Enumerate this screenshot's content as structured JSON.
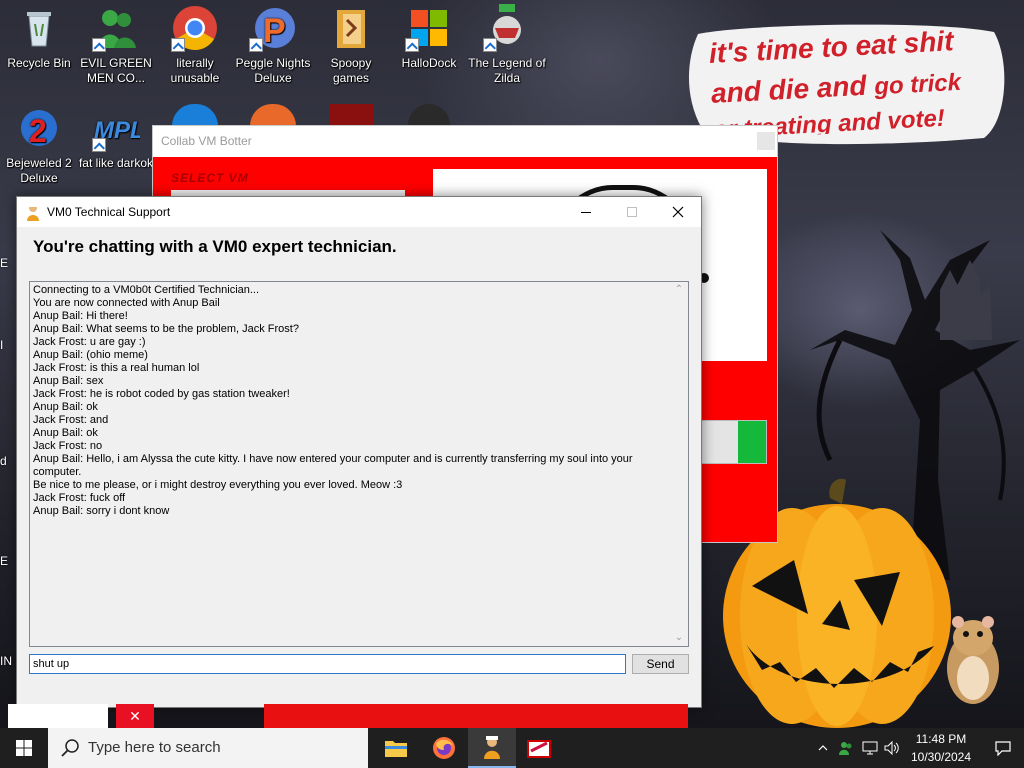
{
  "desktop": {
    "icons": [
      {
        "label": "Recycle Bin"
      },
      {
        "label": "EVIL GREEN MEN CO..."
      },
      {
        "label": "literally unusable"
      },
      {
        "label": "Peggle Nights Deluxe"
      },
      {
        "label": "Spoopy games"
      },
      {
        "label": "HalloDock"
      },
      {
        "label": "The Legend of Zilda"
      },
      {
        "label": "Bejeweled 2 Deluxe"
      },
      {
        "label": "fat like darkok"
      }
    ],
    "wallpaper_caption_line1": "it's time to eat shit",
    "wallpaper_caption_line2a": "and die and ",
    "wallpaper_caption_line2b": "go trick",
    "wallpaper_caption_line3": "or treating and vote!"
  },
  "botter": {
    "title": "Collab VM Botter",
    "select_label": "SELECT VM"
  },
  "support": {
    "title": "VM0 Technical Support",
    "heading": "You're chatting with a VM0 expert technician.",
    "chat_lines": [
      "Connecting to a VM0b0t Certified Technician...",
      "You are now connected with Anup Bail",
      "Anup Bail: Hi there!",
      "Anup Bail: What seems to be the problem, Jack Frost?",
      "Jack Frost: u are gay :)",
      "Anup Bail: (ohio meme)",
      "Jack Frost: is this a real human lol",
      "Anup Bail: sex",
      "Jack Frost: he is robot coded by gas station tweaker!",
      "Anup Bail: ok",
      "Jack Frost: and",
      "Anup Bail: ok",
      "Jack Frost: no",
      "Anup Bail: Hello, i am Alyssa the cute kitty. I have now entered your computer and is currently transferring my soul into your computer.",
      "Be nice to me please, or i might destroy everything you ever loved. Meow :3",
      "Jack Frost: fuck off",
      "Anup Bail: sorry i dont know"
    ],
    "message_input_value": "shut up",
    "send_label": "Send"
  },
  "taskbar": {
    "search_placeholder": "Type here to search",
    "time": "11:48 PM",
    "date": "10/30/2024"
  },
  "colors": {
    "accent_red": "#ff0000",
    "send_border": "#adadad",
    "input_focus": "#2e7ac8",
    "progress_green": "#14b83a"
  }
}
